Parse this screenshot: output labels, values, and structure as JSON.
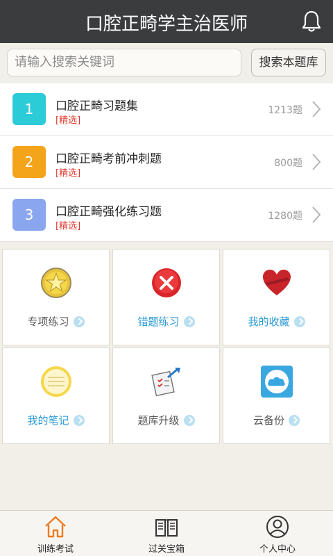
{
  "header": {
    "title": "口腔正畸学主治医师",
    "bell_icon": "bell-icon"
  },
  "search": {
    "placeholder": "请输入搜索关键词",
    "button_label": "搜索本题库"
  },
  "sets": [
    {
      "number": "1",
      "title": "口腔正畸习题集",
      "tag": "[精选]",
      "count": "1213题",
      "color": "#2ccbd8"
    },
    {
      "number": "2",
      "title": "口腔正畸考前冲刺题",
      "tag": "[精选]",
      "count": "800题",
      "color": "#f4a41a"
    },
    {
      "number": "3",
      "title": "口腔正畸强化练习题",
      "tag": "[精选]",
      "count": "1280题",
      "color": "#8aa6ef"
    }
  ],
  "tiles": [
    {
      "label": "专项练习",
      "icon": "star-badge-icon",
      "label_color": "#555555"
    },
    {
      "label": "错题练习",
      "icon": "error-x-icon",
      "label_color": "#2a9ad8"
    },
    {
      "label": "我的收藏",
      "icon": "heart-icon",
      "label_color": "#2a9ad8"
    },
    {
      "label": "我的笔记",
      "icon": "notepad-icon",
      "label_color": "#2a9ad8"
    },
    {
      "label": "题库升级",
      "icon": "upgrade-doc-icon",
      "label_color": "#555555"
    },
    {
      "label": "云备份",
      "icon": "cloud-icon",
      "label_color": "#555555"
    }
  ],
  "tabbar": [
    {
      "label": "训练考试",
      "icon": "home-icon",
      "active": true
    },
    {
      "label": "过关宝箱",
      "icon": "book-icon",
      "active": false
    },
    {
      "label": "个人中心",
      "icon": "user-icon",
      "active": false
    }
  ],
  "colors": {
    "header_bg": "#3a3c3e",
    "active_tab": "#ef7a1f",
    "accent_blue": "#2a9ad8",
    "tag_red": "#e43b2f"
  }
}
